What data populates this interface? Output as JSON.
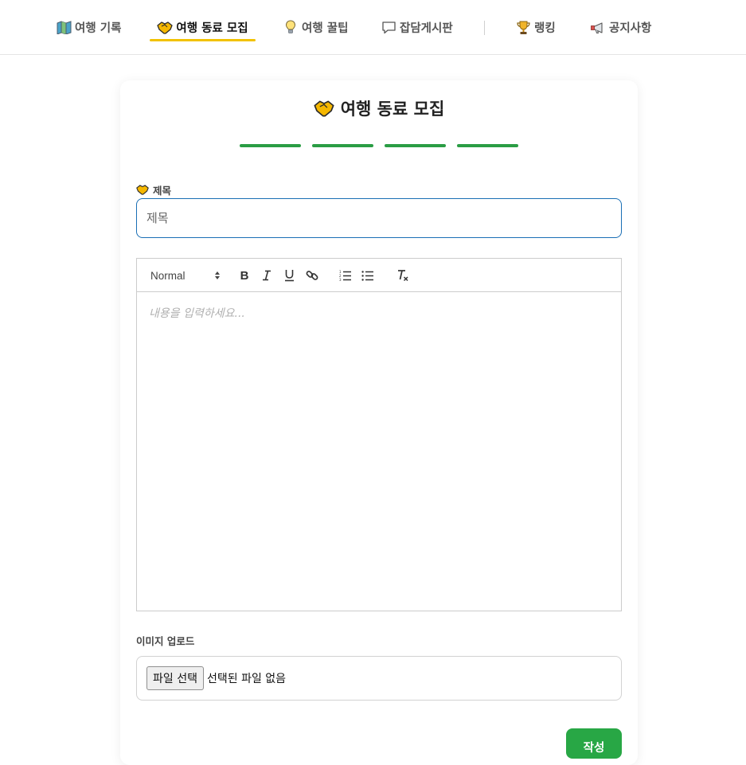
{
  "nav": {
    "items": [
      {
        "label": "여행 기록",
        "icon": "map-icon",
        "active": false
      },
      {
        "label": "여행 동료 모집",
        "icon": "handshake-icon",
        "active": true
      },
      {
        "label": "여행 꿀팁",
        "icon": "lightbulb-icon",
        "active": false
      },
      {
        "label": "잡담게시판",
        "icon": "speech-bubble-icon",
        "active": false
      },
      {
        "label": "랭킹",
        "icon": "trophy-icon",
        "active": false
      },
      {
        "label": "공지사항",
        "icon": "megaphone-icon",
        "active": false
      }
    ],
    "active_underline_color": "#f2c200"
  },
  "form": {
    "heading": "여행 동료 모집",
    "heading_icon": "handshake-icon",
    "progress_steps": 4,
    "step_color": "#2a9d44",
    "title_label": "제목",
    "title_placeholder": "제목",
    "editor": {
      "format_select": "Normal",
      "toolbar_buttons": [
        "bold",
        "italic",
        "underline",
        "link",
        "ordered-list",
        "bullet-list",
        "clear-format"
      ],
      "placeholder": "내용을 입력하세요..."
    },
    "upload_label": "이미지 업로드",
    "file_button": "파일 선택",
    "file_status": "선택된 파일 없음",
    "submit_label": "작성",
    "submit_color": "#28a745"
  }
}
